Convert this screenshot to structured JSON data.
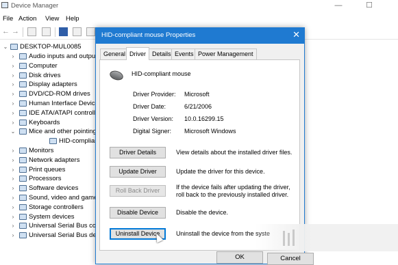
{
  "window": {
    "title": "Device Manager",
    "controls": [
      "—",
      "☐",
      "✕"
    ]
  },
  "menu": [
    "File",
    "Action",
    "View",
    "Help"
  ],
  "tree": {
    "root": "DESKTOP-MUL0085",
    "items": [
      {
        "label": "Audio inputs and outpu",
        "expanded": false
      },
      {
        "label": "Computer",
        "expanded": false
      },
      {
        "label": "Disk drives",
        "expanded": false
      },
      {
        "label": "Display adapters",
        "expanded": false
      },
      {
        "label": "DVD/CD-ROM drives",
        "expanded": false
      },
      {
        "label": "Human Interface Device",
        "expanded": false
      },
      {
        "label": "IDE ATA/ATAPI controlle",
        "expanded": false
      },
      {
        "label": "Keyboards",
        "expanded": false
      },
      {
        "label": "Mice and other pointing",
        "expanded": true
      },
      {
        "label": "HID-compliant mou",
        "child": true
      },
      {
        "label": "Monitors",
        "expanded": false
      },
      {
        "label": "Network adapters",
        "expanded": false
      },
      {
        "label": "Print queues",
        "expanded": false
      },
      {
        "label": "Processors",
        "expanded": false
      },
      {
        "label": "Software devices",
        "expanded": false
      },
      {
        "label": "Sound, video and game",
        "expanded": false
      },
      {
        "label": "Storage controllers",
        "expanded": false
      },
      {
        "label": "System devices",
        "expanded": false
      },
      {
        "label": "Universal Serial Bus con",
        "expanded": false
      },
      {
        "label": "Universal Serial Bus dev",
        "expanded": false
      }
    ]
  },
  "dialog": {
    "title": "HID-compliant mouse Properties",
    "close": "✕",
    "tabs": [
      "General",
      "Driver",
      "Details",
      "Events",
      "Power Management"
    ],
    "active_tab": "Driver",
    "device_name": "HID-compliant mouse",
    "info": [
      {
        "label": "Driver Provider:",
        "value": "Microsoft"
      },
      {
        "label": "Driver Date:",
        "value": "6/21/2006"
      },
      {
        "label": "Driver Version:",
        "value": "10.0.16299.15"
      },
      {
        "label": "Digital Signer:",
        "value": "Microsoft Windows"
      }
    ],
    "actions": [
      {
        "button": "Driver Details",
        "desc": "View details about the installed driver files.",
        "disabled": false
      },
      {
        "button": "Update Driver",
        "desc": "Update the driver for this device.",
        "disabled": false
      },
      {
        "button": "Roll Back Driver",
        "desc": "If the device fails after updating the driver, roll back to the previously installed driver.",
        "disabled": true
      },
      {
        "button": "Disable Device",
        "desc": "Disable the device.",
        "disabled": false
      },
      {
        "button": "Uninstall Device",
        "desc": "Uninstall the device from the syste",
        "disabled": false
      }
    ],
    "ok": "OK",
    "cancel": "Cancel"
  },
  "colors": {
    "accent": "#1f7ad1",
    "dialog_bg": "#f0f0f0",
    "button_bg": "#e1e1e1"
  }
}
